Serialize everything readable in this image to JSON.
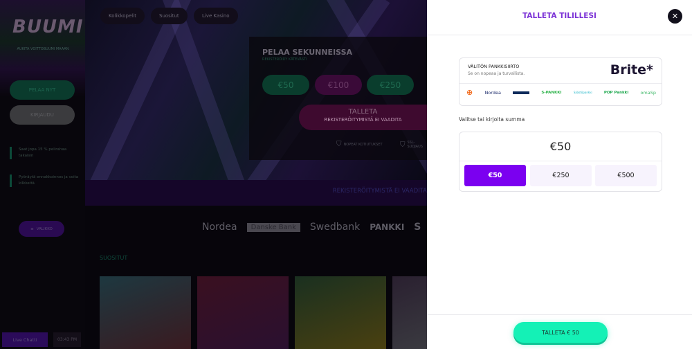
{
  "sidebar": {
    "logo": "BUUMI",
    "tagline": "AUKITA VOITTOBUUMI MAAAN",
    "play_label": "PELAA NYT",
    "login_label": "KIRJAUDU",
    "promos": [
      "Saat jopa 15 % pelirahaa takaisin",
      "Pyöräytä ennakkoinnos ja voita kilkkeitä"
    ],
    "menu_label": "VALIKKO",
    "live_chat_label": "Live Chatti",
    "time": "03:43 PM"
  },
  "nav": {
    "pills": [
      "Kolikkopelit",
      "Suositut",
      "Live Kasino"
    ]
  },
  "hero": {
    "title": "PELAA SEKUNNEISSA",
    "subtitle": "REKISTERÖIDY KÄTEVÄSTI",
    "amounts": [
      "€50",
      "€100",
      "€250"
    ],
    "deposit_label": "TALLETA",
    "deposit_sub": "REKISTERÖITYMISTÄ EI VAADITA",
    "trust": [
      "NOPEAT KOTIUTUKSET",
      "SSL-SUOJAUS"
    ]
  },
  "band_text": "REKISTERÖITYMISTÄ EI VAADITA",
  "banks": [
    "Nordea",
    "Danske Bank",
    "Swedbank",
    "PANKKI",
    "S"
  ],
  "section_title": "SUOSITUT",
  "panel": {
    "title": "TALLETA TILILLESI",
    "method": {
      "title": "VÄLITÖN PANKKISIIRTO",
      "subtitle": "Se on nopeaa ja turvallista.",
      "brand": "Brite*",
      "banks": [
        "OP",
        "Nordea",
        "Danske Bank",
        "S-PANKKI",
        "Säästöpankki",
        "POP Pankki",
        "omaSp"
      ]
    },
    "amount_label": "Valitse tai kirjoita summa",
    "amount_value": "€50",
    "choices": [
      "€50",
      "€250",
      "€500"
    ],
    "selected": "€50",
    "submit_label": "TALLETA € 50"
  },
  "colors": {
    "accent": "#7b00f0",
    "title": "#7b32d6",
    "submit": "#14f1b6"
  }
}
